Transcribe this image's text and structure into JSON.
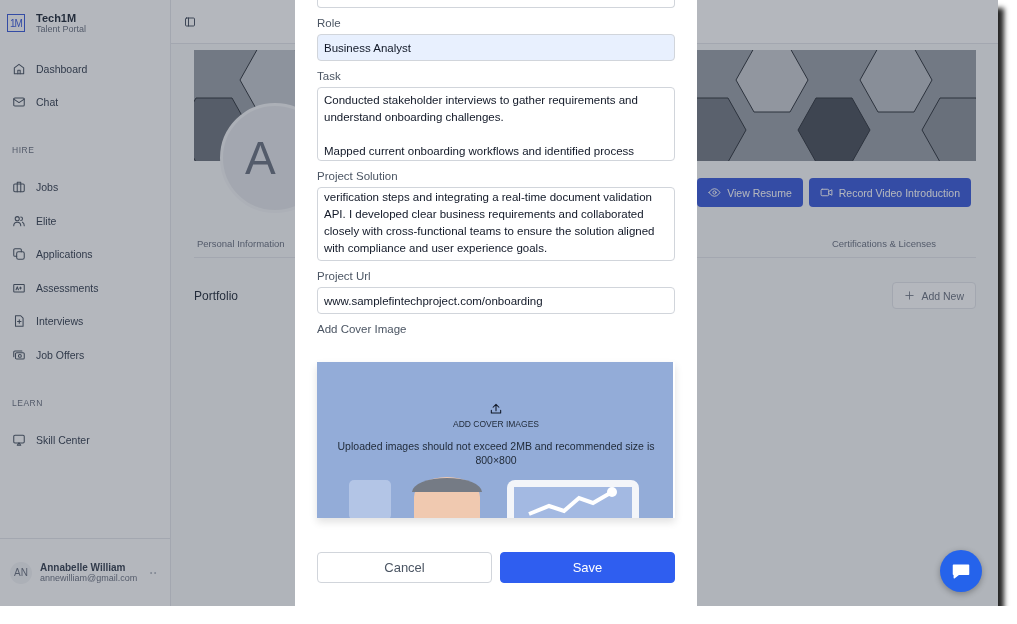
{
  "sidebar": {
    "brand": {
      "logo": "1M",
      "name": "Tech1M",
      "subtitle": "Talent Portal"
    },
    "groups": [
      {
        "items": [
          {
            "label": "Dashboard",
            "selected": false
          },
          {
            "label": "Chat",
            "selected": false
          }
        ]
      },
      {
        "heading": "HIRE",
        "items": [
          {
            "label": "Jobs",
            "selected": false
          },
          {
            "label": "Elite",
            "selected": false
          },
          {
            "label": "Applications",
            "selected": false
          },
          {
            "label": "Assessments",
            "selected": false
          },
          {
            "label": "Interviews",
            "selected": false
          },
          {
            "label": "Job Offers",
            "selected": false
          }
        ]
      },
      {
        "heading": "LEARN",
        "items": [
          {
            "label": "Skill Center",
            "selected": false
          }
        ]
      }
    ],
    "user": {
      "initials": "AN",
      "name": "Annabelle William",
      "email": "annewilliam@gmail.com"
    }
  },
  "profile": {
    "avatar_initials": "A",
    "buttons": [
      {
        "label": "View Resume"
      },
      {
        "label": "Record Video Introduction"
      }
    ]
  },
  "tabs": [
    {
      "label": "Personal Information",
      "selected": false
    },
    {
      "label": "Certifications & Licenses",
      "selected": false
    }
  ],
  "section": {
    "title": "Portfolio",
    "add_button": "Add New"
  },
  "modal": {
    "fields": [
      {
        "kind": "input",
        "label": "Role",
        "value": "Business Analyst",
        "autofilled": true
      },
      {
        "kind": "textarea",
        "label": "Task",
        "value": "Conducted stakeholder interviews to gather requirements and understand onboarding challenges.\n\nMapped current onboarding workflows and identified process",
        "autofilled": false
      },
      {
        "kind": "textarea",
        "label": "Project Solution",
        "value": "verification steps and integrating a real-time document validation API. I developed clear business requirements and collaborated closely with cross-functional teams to ensure the solution aligned with compliance and user experience goals.",
        "autofilled": false
      },
      {
        "kind": "input",
        "label": "Project Url",
        "value": "www.samplefintechproject.com/onboarding",
        "autofilled": false
      }
    ],
    "cover": {
      "label": "Add Cover Image",
      "title": "ADD COVER IMAGES",
      "hint": "Uploaded images should not exceed 2MB and recommended size is 800×800"
    },
    "buttons": [
      {
        "label": "Cancel",
        "kind": "secondary"
      },
      {
        "label": "Save",
        "kind": "primary"
      }
    ]
  }
}
